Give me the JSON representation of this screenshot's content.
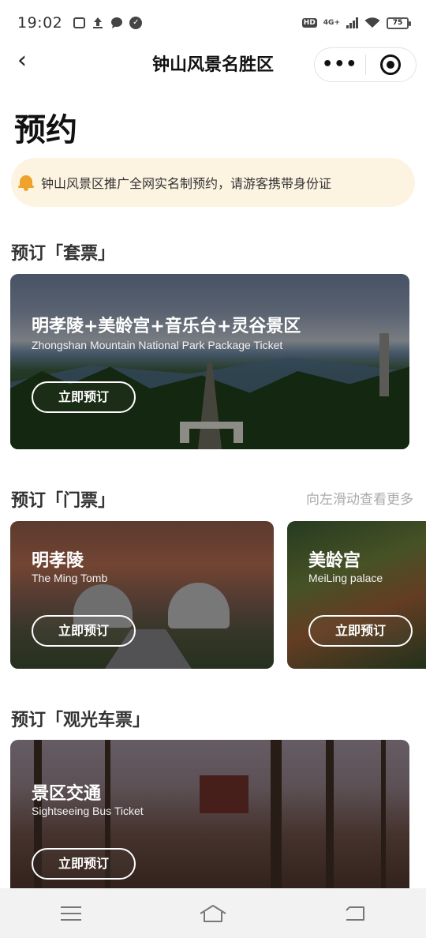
{
  "status_bar": {
    "time": "19:02",
    "network": "4G+",
    "hd": "HD",
    "battery": "75"
  },
  "nav": {
    "back_icon": "chevron-left-icon",
    "title": "钟山风景名胜区",
    "more_icon": "more-dots-icon",
    "close_icon": "target-close-icon"
  },
  "page": {
    "title": "预约"
  },
  "notice": {
    "icon": "bell-icon",
    "text": "钟山风景区推广全网实名制预约，请游客携带身份证",
    "icon_color": "#f0a32c",
    "background": "#fdf3e1"
  },
  "package_section": {
    "title": "预订「套票」",
    "card": {
      "title": "明孝陵+美龄宫+音乐台+灵谷景区",
      "subtitle": "Zhongshan Mountain National Park Package Ticket",
      "button": "立即预订"
    }
  },
  "ticket_section": {
    "title": "预订「门票」",
    "hint": "向左滑动查看更多",
    "cards": [
      {
        "title": "明孝陵",
        "subtitle": "The Ming Tomb",
        "button": "立即预订"
      },
      {
        "title": "美龄宫",
        "subtitle": "MeiLing palace",
        "button": "立即预订"
      }
    ]
  },
  "bus_section": {
    "title": "预订「观光车票」",
    "card": {
      "title": "景区交通",
      "subtitle": "Sightseeing Bus Ticket",
      "button": "立即预订"
    }
  },
  "system_nav": {
    "menu_icon": "menu-icon",
    "home_icon": "home-icon",
    "back_icon": "back-icon"
  }
}
